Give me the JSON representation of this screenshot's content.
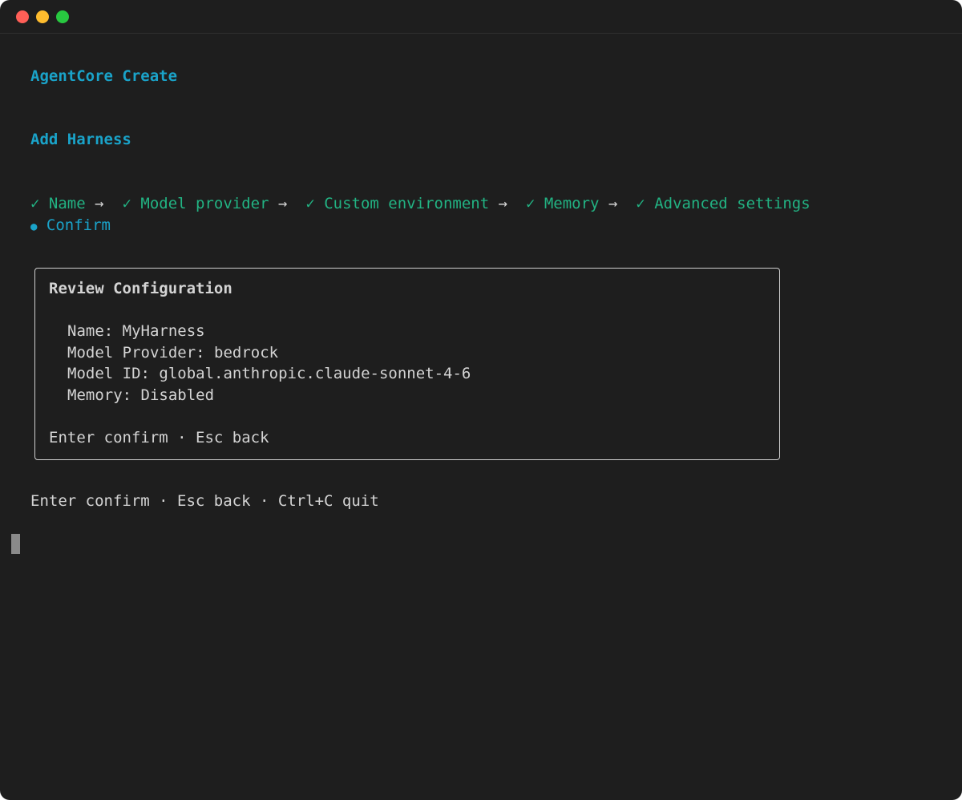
{
  "app_title": "AgentCore Create",
  "section_title": "Add Harness",
  "steps": [
    {
      "mark": "✓",
      "label": "Name",
      "arrow": "→"
    },
    {
      "mark": "✓",
      "label": "Model provider",
      "arrow": "→"
    },
    {
      "mark": "✓",
      "label": "Custom environment",
      "arrow": "→"
    },
    {
      "mark": "✓",
      "label": "Memory",
      "arrow": "→"
    },
    {
      "mark": "✓",
      "label": "Advanced settings",
      "arrow": ""
    },
    {
      "mark": "●",
      "label": "Confirm",
      "arrow": ""
    }
  ],
  "review": {
    "title": "Review Configuration",
    "fields": [
      {
        "label": "Name:",
        "value": "MyHarness"
      },
      {
        "label": "Model Provider:",
        "value": "bedrock"
      },
      {
        "label": "Model ID:",
        "value": "global.anthropic.claude-sonnet-4-6"
      },
      {
        "label": "Memory:",
        "value": "Disabled"
      }
    ],
    "hint": "Enter confirm · Esc back"
  },
  "footer_hint": "Enter confirm · Esc back · Ctrl+C quit",
  "colors": {
    "background": "#1e1e1e",
    "accent_cyan": "#1aa3c9",
    "done_green": "#22b383",
    "text": "#d4d4d4"
  }
}
